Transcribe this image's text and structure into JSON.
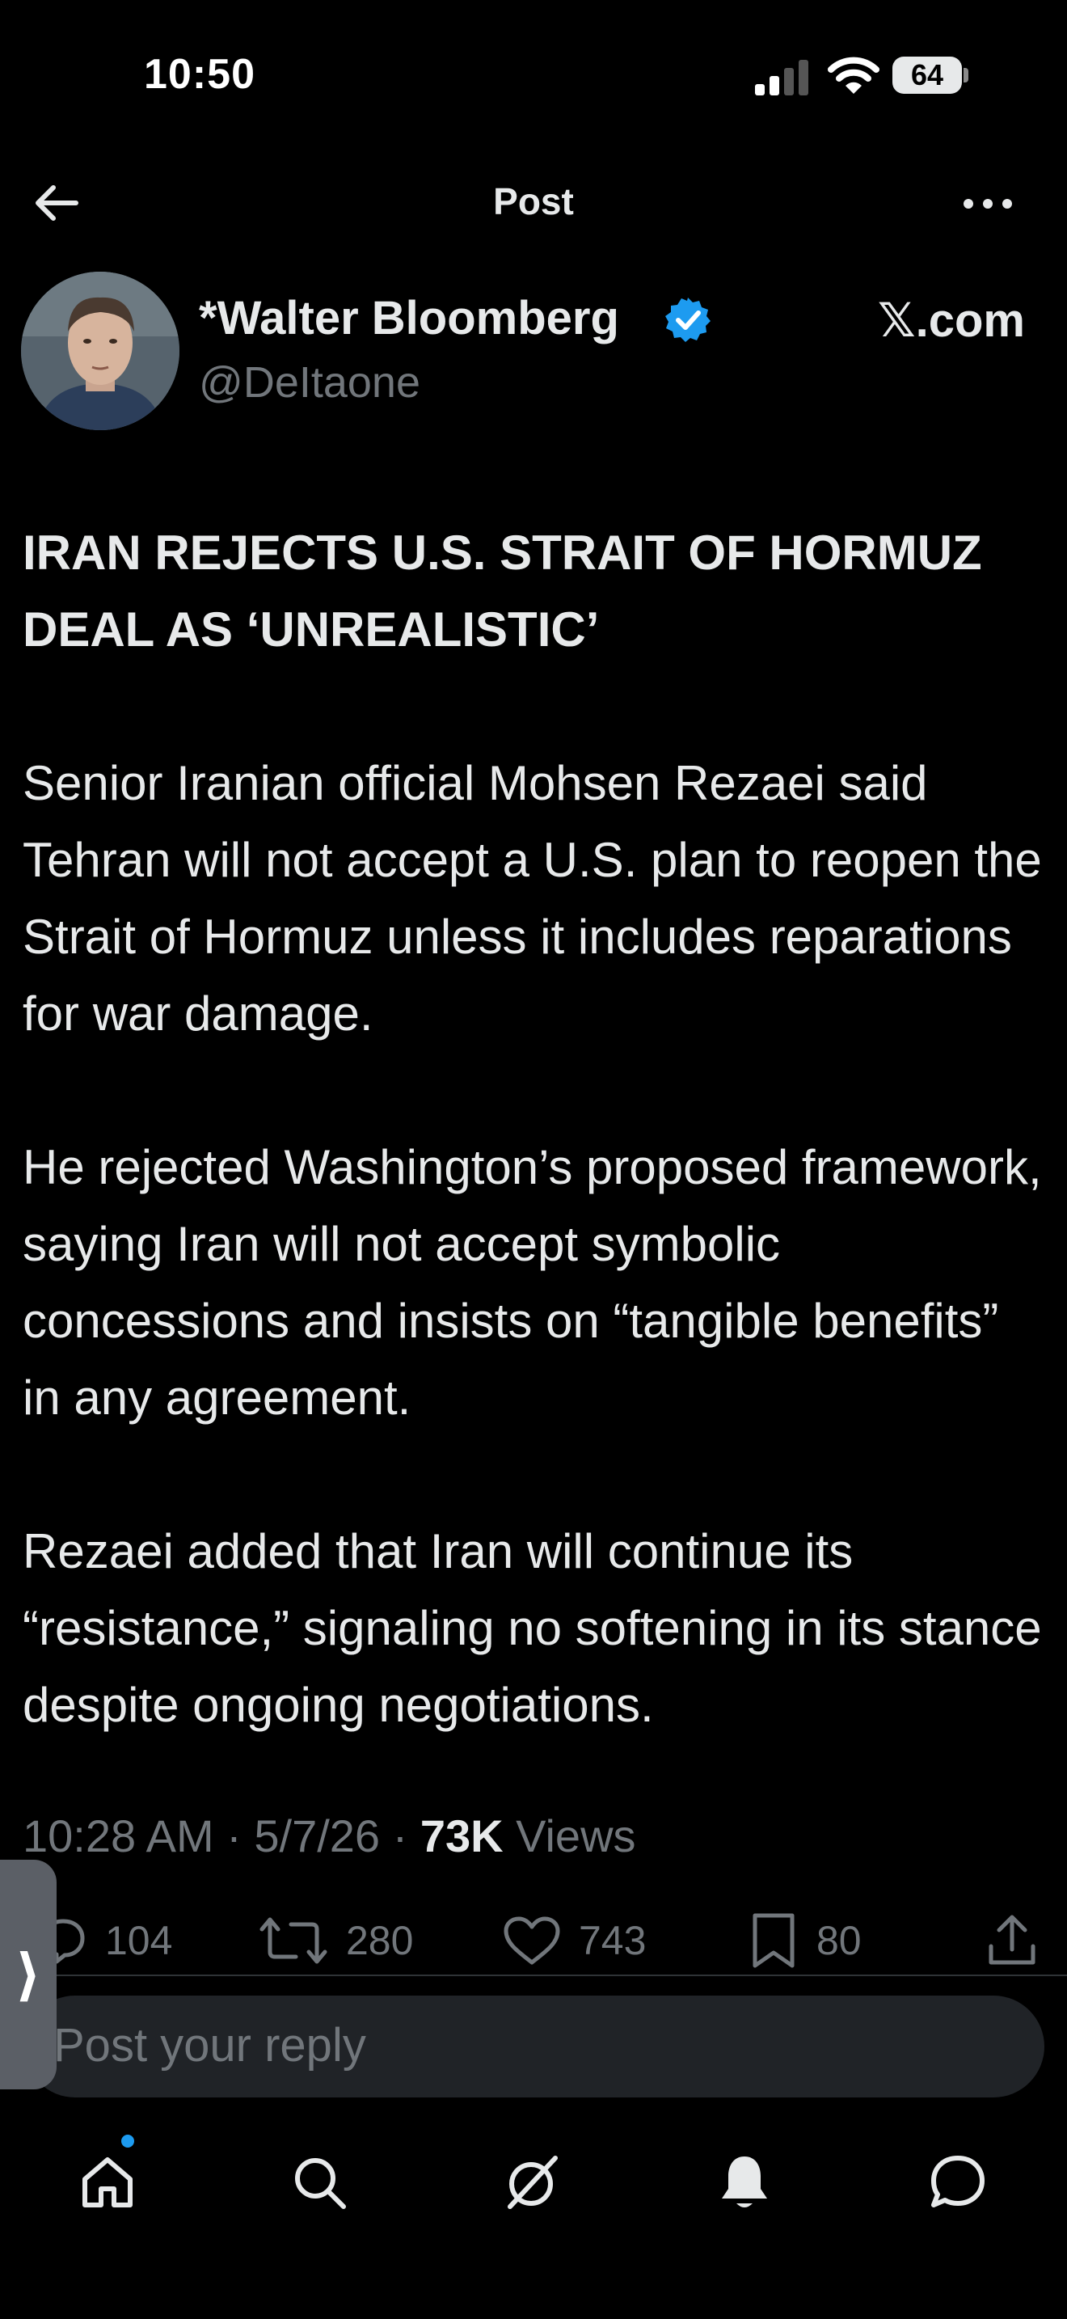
{
  "status_bar": {
    "time": "10:50",
    "battery": "64"
  },
  "header": {
    "title": "Post"
  },
  "author": {
    "name": "*Walter Bloomberg",
    "handle": "@DeItaone",
    "source": "𝕏.com"
  },
  "post": {
    "headline": "IRAN REJECTS U.S. STRAIT OF HORMUZ DEAL AS ‘UNREALISTIC’",
    "paragraphs": [
      "Senior Iranian official Mohsen Rezaei said Tehran will not accept a U.S. plan to reopen the Strait of Hormuz unless it includes reparations for war damage.",
      "He rejected Washington’s proposed framework, saying Iran will not accept symbolic concessions and insists on “tangible benefits” in any agreement.",
      "Rezaei added that Iran will continue its “resistance,” signaling no softening in its stance despite ongoing negotiations."
    ],
    "time": "10:28 AM",
    "date": "5/7/26",
    "views_count": "73K",
    "views_label": "Views"
  },
  "actions": {
    "replies": "104",
    "reposts": "280",
    "likes": "743",
    "bookmarks": "80"
  },
  "reply": {
    "placeholder": "Post your reply"
  },
  "side_tab": {
    "label": "⟩"
  },
  "colors": {
    "background": "#000000",
    "text": "#e7e9ea",
    "muted": "#71767b",
    "accent": "#1d9bf0"
  },
  "icons": [
    "back-arrow-icon",
    "more-icon",
    "verified-icon",
    "reply-icon",
    "repost-icon",
    "like-icon",
    "bookmark-icon",
    "share-icon",
    "home-icon",
    "search-icon",
    "grok-icon",
    "notifications-icon",
    "messages-icon"
  ]
}
